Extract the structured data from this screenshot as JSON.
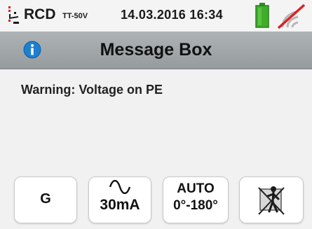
{
  "statusbar": {
    "mode": "RCD",
    "mode_sub": "TT-50V",
    "datetime": "14.03.2016  16:34",
    "mode_icon": "rcd-symbol-icon",
    "battery_icon": "battery-icon",
    "battery_level": 1.0,
    "wireless_icon": "wireless-disabled-icon"
  },
  "titlebar": {
    "icon": "info-icon",
    "title": "Message Box"
  },
  "message": {
    "text": "Warning: Voltage on PE"
  },
  "softkeys": {
    "key1": {
      "label": "G"
    },
    "key2": {
      "icon": "ac-sine-wave-icon",
      "label": "30mA"
    },
    "key3": {
      "label_top": "AUTO",
      "label_bottom": "0°-180°"
    },
    "key4": {
      "icon": "no-touch-person-icon"
    }
  },
  "colors": {
    "titlebar": "#a3a9ab",
    "battery": "#3fae2a",
    "info_icon": "#1e7fd0",
    "wireless_strike": "#e02020"
  }
}
